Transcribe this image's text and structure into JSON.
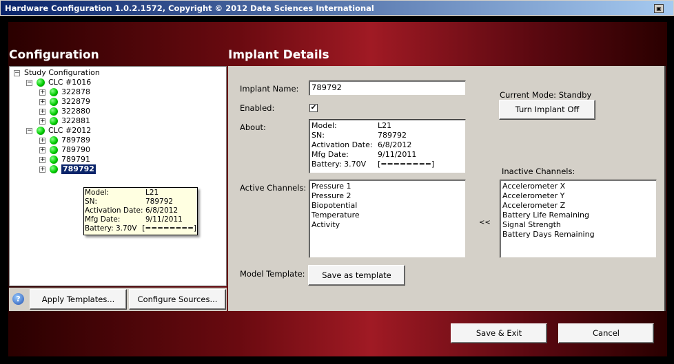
{
  "window": {
    "title": "Hardware Configuration 1.0.2.1572, Copyright © 2012 Data Sciences International"
  },
  "left": {
    "title": "Configuration",
    "tree": {
      "root": "Study Configuration",
      "groups": [
        {
          "label": "CLC #1016",
          "items": [
            "322878",
            "322879",
            "322880",
            "322881"
          ]
        },
        {
          "label": "CLC #2012",
          "items": [
            "789789",
            "789790",
            "789791",
            "789792"
          ]
        }
      ],
      "selected": "789792"
    },
    "tooltip": [
      [
        "Model:",
        "L21"
      ],
      [
        "SN:",
        "789792"
      ],
      [
        "Activation Date:",
        "6/8/2012"
      ],
      [
        "Mfg Date:",
        "9/11/2011"
      ],
      [
        "Battery:  3.70V",
        "[========]"
      ]
    ],
    "apply_templates": "Apply Templates...",
    "configure_sources": "Configure Sources..."
  },
  "right": {
    "title": "Implant Details",
    "implant_name_label": "Implant Name:",
    "implant_name": "789792",
    "enabled_label": "Enabled:",
    "enabled": true,
    "about_label": "About:",
    "about": [
      [
        "Model:",
        "L21"
      ],
      [
        "SN:",
        "789792"
      ],
      [
        "Activation Date:",
        "6/8/2012"
      ],
      [
        "Mfg Date:",
        "9/11/2011"
      ],
      [
        "Battery: 3.70V",
        "[========]"
      ]
    ],
    "current_mode": "Current Mode: Standby",
    "turn_off": "Turn Implant Off",
    "active_label": "Active Channels:",
    "active": [
      "Pressure 1",
      "Pressure 2",
      "Biopotential",
      "Temperature",
      "Activity"
    ],
    "move_button": "<<",
    "inactive_label": "Inactive Channels:",
    "inactive": [
      "Accelerometer X",
      "Accelerometer Y",
      "Accelerometer Z",
      "Battery Life Remaining",
      "Signal Strength",
      "Battery Days Remaining"
    ],
    "template_label": "Model Template:",
    "save_template": "Save as template"
  },
  "footer": {
    "save_exit": "Save & Exit",
    "cancel": "Cancel"
  }
}
